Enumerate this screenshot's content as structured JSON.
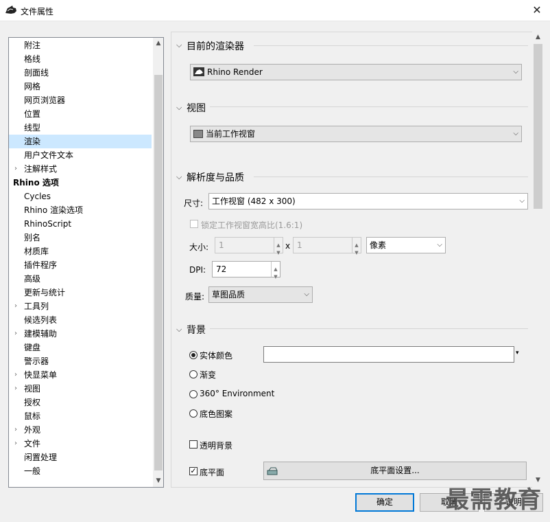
{
  "window": {
    "title": "文件属性",
    "close_glyph": "✕"
  },
  "tree": {
    "items": [
      {
        "label": "附注",
        "level": 1,
        "expandable": false
      },
      {
        "label": "格线",
        "level": 1,
        "expandable": false
      },
      {
        "label": "剖面线",
        "level": 1,
        "expandable": false
      },
      {
        "label": "网格",
        "level": 1,
        "expandable": false
      },
      {
        "label": "网页浏览器",
        "level": 1,
        "expandable": false
      },
      {
        "label": "位置",
        "level": 1,
        "expandable": false
      },
      {
        "label": "线型",
        "level": 1,
        "expandable": false
      },
      {
        "label": "渲染",
        "level": 1,
        "expandable": false,
        "selected": true
      },
      {
        "label": "用户文件文本",
        "level": 1,
        "expandable": false
      },
      {
        "label": "注解样式",
        "level": 1,
        "expandable": true
      },
      {
        "label": "Rhino 选项",
        "level": 0,
        "expandable": false
      },
      {
        "label": "Cycles",
        "level": 1,
        "expandable": false
      },
      {
        "label": "Rhino 渲染选项",
        "level": 1,
        "expandable": false
      },
      {
        "label": "RhinoScript",
        "level": 1,
        "expandable": false
      },
      {
        "label": "别名",
        "level": 1,
        "expandable": false
      },
      {
        "label": "材质库",
        "level": 1,
        "expandable": false
      },
      {
        "label": "插件程序",
        "level": 1,
        "expandable": false
      },
      {
        "label": "高级",
        "level": 1,
        "expandable": false
      },
      {
        "label": "更新与统计",
        "level": 1,
        "expandable": false
      },
      {
        "label": "工具列",
        "level": 1,
        "expandable": true
      },
      {
        "label": "候选列表",
        "level": 1,
        "expandable": false
      },
      {
        "label": "建模辅助",
        "level": 1,
        "expandable": true
      },
      {
        "label": "键盘",
        "level": 1,
        "expandable": false
      },
      {
        "label": "警示器",
        "level": 1,
        "expandable": false
      },
      {
        "label": "快显菜单",
        "level": 1,
        "expandable": true
      },
      {
        "label": "视图",
        "level": 1,
        "expandable": true
      },
      {
        "label": "授权",
        "level": 1,
        "expandable": false
      },
      {
        "label": "鼠标",
        "level": 1,
        "expandable": false
      },
      {
        "label": "外观",
        "level": 1,
        "expandable": true
      },
      {
        "label": "文件",
        "level": 1,
        "expandable": true
      },
      {
        "label": "闲置处理",
        "level": 1,
        "expandable": false
      },
      {
        "label": "一般",
        "level": 1,
        "expandable": false
      }
    ]
  },
  "renderer": {
    "title": "目前的渲染器",
    "selected": "Rhino Render"
  },
  "view": {
    "title": "视图",
    "selected": "当前工作视窗"
  },
  "resolution": {
    "title": "解析度与品质",
    "size_label": "尺寸:",
    "size_value": "工作视窗 (482 x 300)",
    "lock_label": "锁定工作视窗宽高比(1.6:1)",
    "lock_checked": false,
    "dims_label": "大小:",
    "width": "1",
    "times": "x",
    "height": "1",
    "unit": "像素",
    "dpi_label": "DPI:",
    "dpi": "72",
    "quality_label": "质量:",
    "quality": "草图品质"
  },
  "background": {
    "title": "背景",
    "options": [
      {
        "label": "实体颜色",
        "checked": true
      },
      {
        "label": "渐变",
        "checked": false
      },
      {
        "label": "360° Environment",
        "checked": false
      },
      {
        "label": "底色图案",
        "checked": false
      }
    ],
    "color_value": "",
    "transparent_label": "透明背景",
    "transparent_checked": false,
    "ground_label": "底平面",
    "ground_checked": true,
    "ground_button": "底平面设置..."
  },
  "buttons": {
    "ok": "确定",
    "cancel": "取消",
    "help": "说明"
  },
  "watermark": "最需教育"
}
